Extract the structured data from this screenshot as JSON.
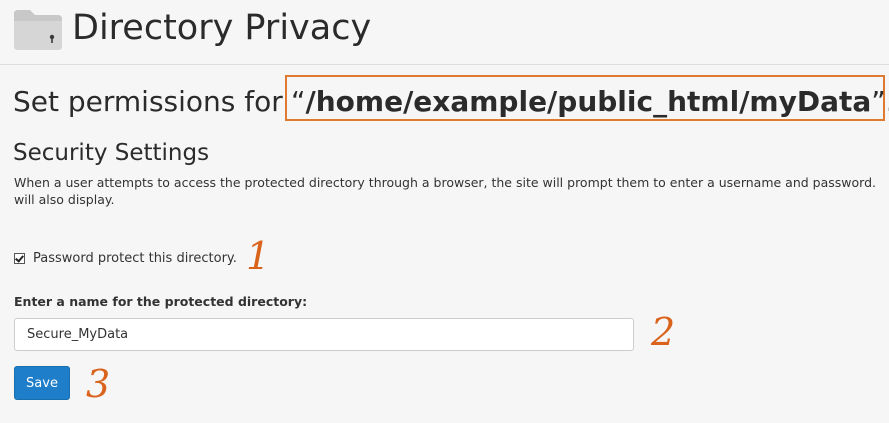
{
  "header": {
    "title": "Directory Privacy",
    "icon": "folder-lock-icon"
  },
  "permissions": {
    "prefix": "Set permissions for ",
    "open_quote": "“",
    "path": "/home/example/public_html/myData",
    "close_quote": "”."
  },
  "security": {
    "title": "Security Settings",
    "description": "When a user attempts to access the protected directory through a browser, the site will prompt them to enter a username and password. will also display."
  },
  "checkbox": {
    "label": "Password protect this directory.",
    "checked": true
  },
  "name_field": {
    "label": "Enter a name for the protected directory:",
    "value": "Secure_MyData"
  },
  "save_button": {
    "label": "Save"
  },
  "annotations": {
    "one": "1",
    "two": "2",
    "three": "3"
  },
  "colors": {
    "accent": "#1f7ec9",
    "annotation": "#d9631b",
    "background": "#f6f6f6"
  }
}
